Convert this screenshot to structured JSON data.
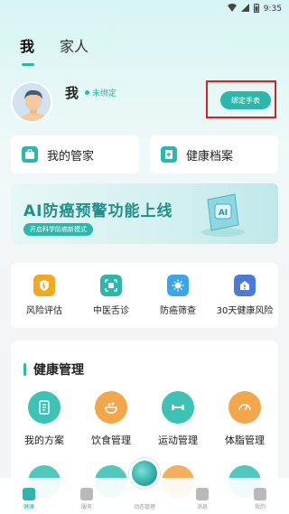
{
  "status_bar": {
    "time": "9:35"
  },
  "tabs": [
    {
      "label": "我",
      "active": true
    },
    {
      "label": "家人",
      "active": false
    }
  ],
  "profile": {
    "name": "我",
    "bind_status": "未绑定",
    "bind_button": "绑定手表"
  },
  "quick_cards": [
    {
      "label": "我的管家",
      "icon": "butler-icon"
    },
    {
      "label": "健康档案",
      "icon": "health-record-icon"
    }
  ],
  "banner": {
    "title": "AI防癌预警功能上线",
    "subtitle": "开启科学防癌新模式",
    "art_text": "AI"
  },
  "features": [
    {
      "label": "风险评估",
      "icon": "risk-assessment-icon",
      "color": "#f5a623"
    },
    {
      "label": "中医舌诊",
      "icon": "tongue-diagnosis-icon",
      "color": "#2bb7a9"
    },
    {
      "label": "防癌筛查",
      "icon": "cancer-screening-icon",
      "color": "#3aa6e8"
    },
    {
      "label": "30天健康风险",
      "icon": "health-risk-icon",
      "color": "#4a7bd9"
    }
  ],
  "health_management": {
    "title": "健康管理",
    "items": [
      {
        "label": "我的方案",
        "icon": "plan-icon",
        "color": "#3dc2b6"
      },
      {
        "label": "饮食管理",
        "icon": "diet-icon",
        "color": "#f3a64a"
      },
      {
        "label": "运动管理",
        "icon": "exercise-icon",
        "color": "#3dc2b6"
      },
      {
        "label": "体脂管理",
        "icon": "body-fat-icon",
        "color": "#f3a64a"
      }
    ]
  },
  "bottom_nav": [
    {
      "label": "健康",
      "icon": "heart-icon",
      "active": true
    },
    {
      "label": "服务",
      "icon": "service-icon",
      "active": false
    },
    {
      "label": "动态管理",
      "icon": "dynamic-icon",
      "active": false
    },
    {
      "label": "消息",
      "icon": "message-icon",
      "active": false
    },
    {
      "label": "我的",
      "icon": "profile-icon",
      "active": false
    }
  ],
  "colors": {
    "accent": "#2bb7a9",
    "highlight": "#e31c23"
  }
}
